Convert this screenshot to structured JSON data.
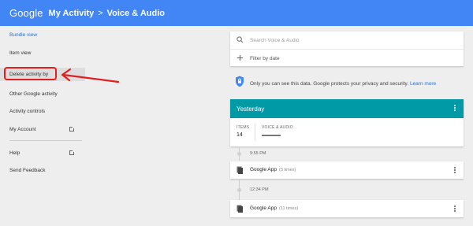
{
  "header": {
    "brand": "Google",
    "title": "My Activity",
    "separator": ">",
    "subtitle": "Voice & Audio"
  },
  "sidebar": {
    "items": [
      {
        "label": "Bundle view"
      },
      {
        "label": "Item view"
      },
      {
        "label": "Delete activity by"
      },
      {
        "label": "Other Google activity"
      },
      {
        "label": "Activity controls"
      },
      {
        "label": "My Account"
      },
      {
        "label": "Help"
      },
      {
        "label": "Send Feedback"
      }
    ]
  },
  "search": {
    "placeholder": "Search Voice & Audio",
    "filter_label": "Filter by date"
  },
  "privacy": {
    "text": "Only you can see this data. Google protects your privacy and security.",
    "link": "Learn more"
  },
  "bundle": {
    "title": "Yesterday",
    "items_label": "ITEMS",
    "items_count": "14",
    "product_label": "VOICE & AUDIO"
  },
  "timeline": [
    {
      "time": "9:55 PM",
      "app": "Google App",
      "count": "(3 times)"
    },
    {
      "time": "12:34 PM",
      "app": "Google App",
      "count": "(11 times)"
    }
  ],
  "colors": {
    "header": "#4285f4",
    "bundle_header": "#009aa6",
    "callout": "#e02020",
    "link": "#1a73e8"
  }
}
